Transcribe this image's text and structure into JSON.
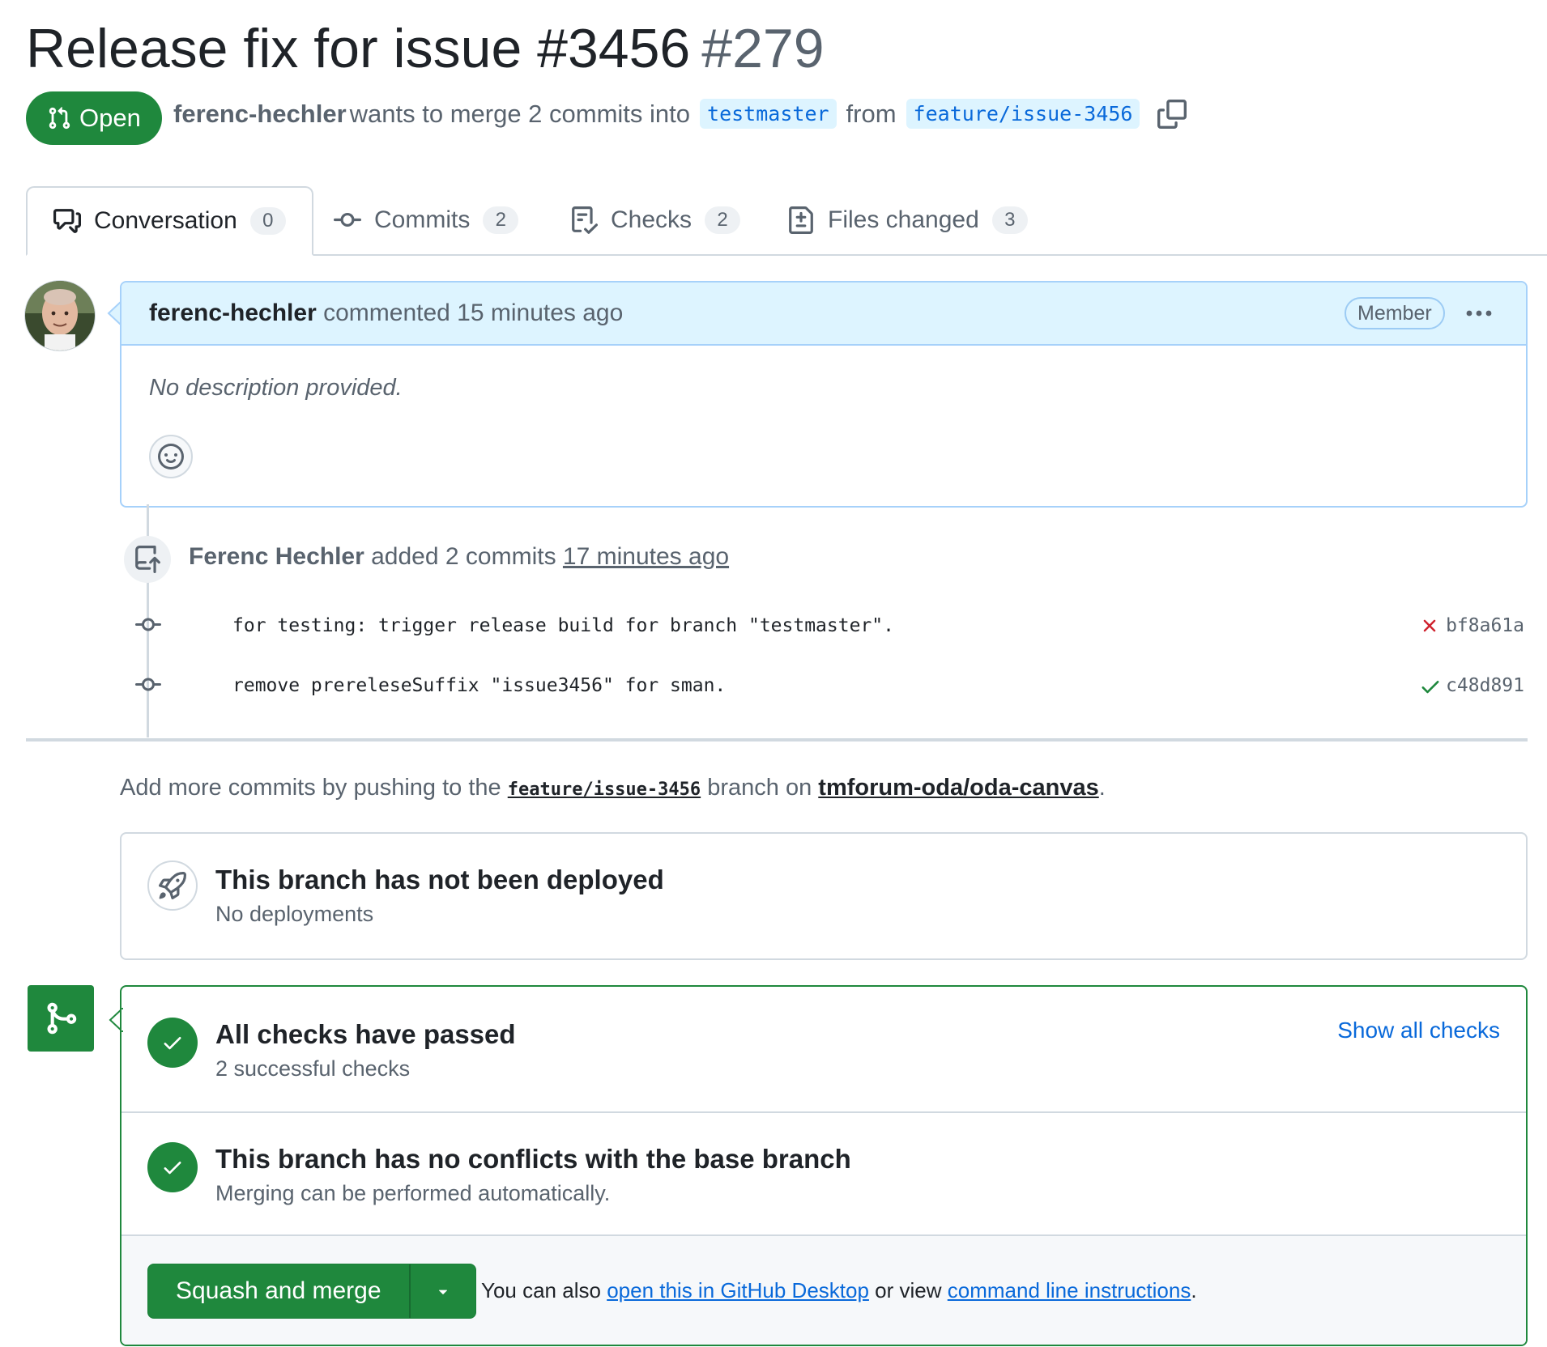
{
  "pr": {
    "title": "Release fix for issue #3456",
    "number": "#279",
    "state": "Open",
    "author": "ferenc-hechler",
    "merge_text": "wants to merge 2 commits into",
    "base_branch": "testmaster",
    "from_text": "from",
    "head_branch": "feature/issue-3456"
  },
  "tabs": [
    {
      "label": "Conversation",
      "count": "0",
      "icon": "comment-discussion-icon"
    },
    {
      "label": "Commits",
      "count": "2",
      "icon": "git-commit-icon"
    },
    {
      "label": "Checks",
      "count": "2",
      "icon": "checklist-icon"
    },
    {
      "label": "Files changed",
      "count": "3",
      "icon": "file-diff-icon"
    }
  ],
  "comment": {
    "author": "ferenc-hechler",
    "action": "commented 15 minutes ago",
    "role": "Member",
    "body": "No description provided."
  },
  "timeline": {
    "pusher": "Ferenc Hechler",
    "pushed_text": "added 2 commits",
    "ago": "17 minutes ago",
    "commits": [
      {
        "message": "for testing: trigger release build for branch \"testmaster\".",
        "sha": "bf8a61a",
        "status": "failure"
      },
      {
        "message": "remove prereleseSuffix \"issue3456\" for sman.",
        "sha": "c48d891",
        "status": "success"
      }
    ]
  },
  "hint": {
    "prefix": "Add more commits by pushing to the",
    "branch": "feature/issue-3456",
    "middle": "branch on",
    "repo": "tmforum-oda/oda-canvas",
    "suffix": "."
  },
  "deploy": {
    "title": "This branch has not been deployed",
    "subtitle": "No deployments"
  },
  "merge": {
    "checks_title": "All checks have passed",
    "checks_sub": "2 successful checks",
    "show_all": "Show all checks",
    "conflicts_title": "This branch has no conflicts with the base branch",
    "conflicts_sub": "Merging can be performed automatically.",
    "button_label": "Squash and merge",
    "also_prefix": "You can also",
    "desktop_link": "open this in GitHub Desktop",
    "or_view": "or view",
    "cli_link": "command line instructions",
    "also_suffix": "."
  },
  "colors": {
    "success": "#1f883d",
    "failure": "#cf222e",
    "link": "#0969da",
    "branch_bg": "#ddf4ff"
  }
}
